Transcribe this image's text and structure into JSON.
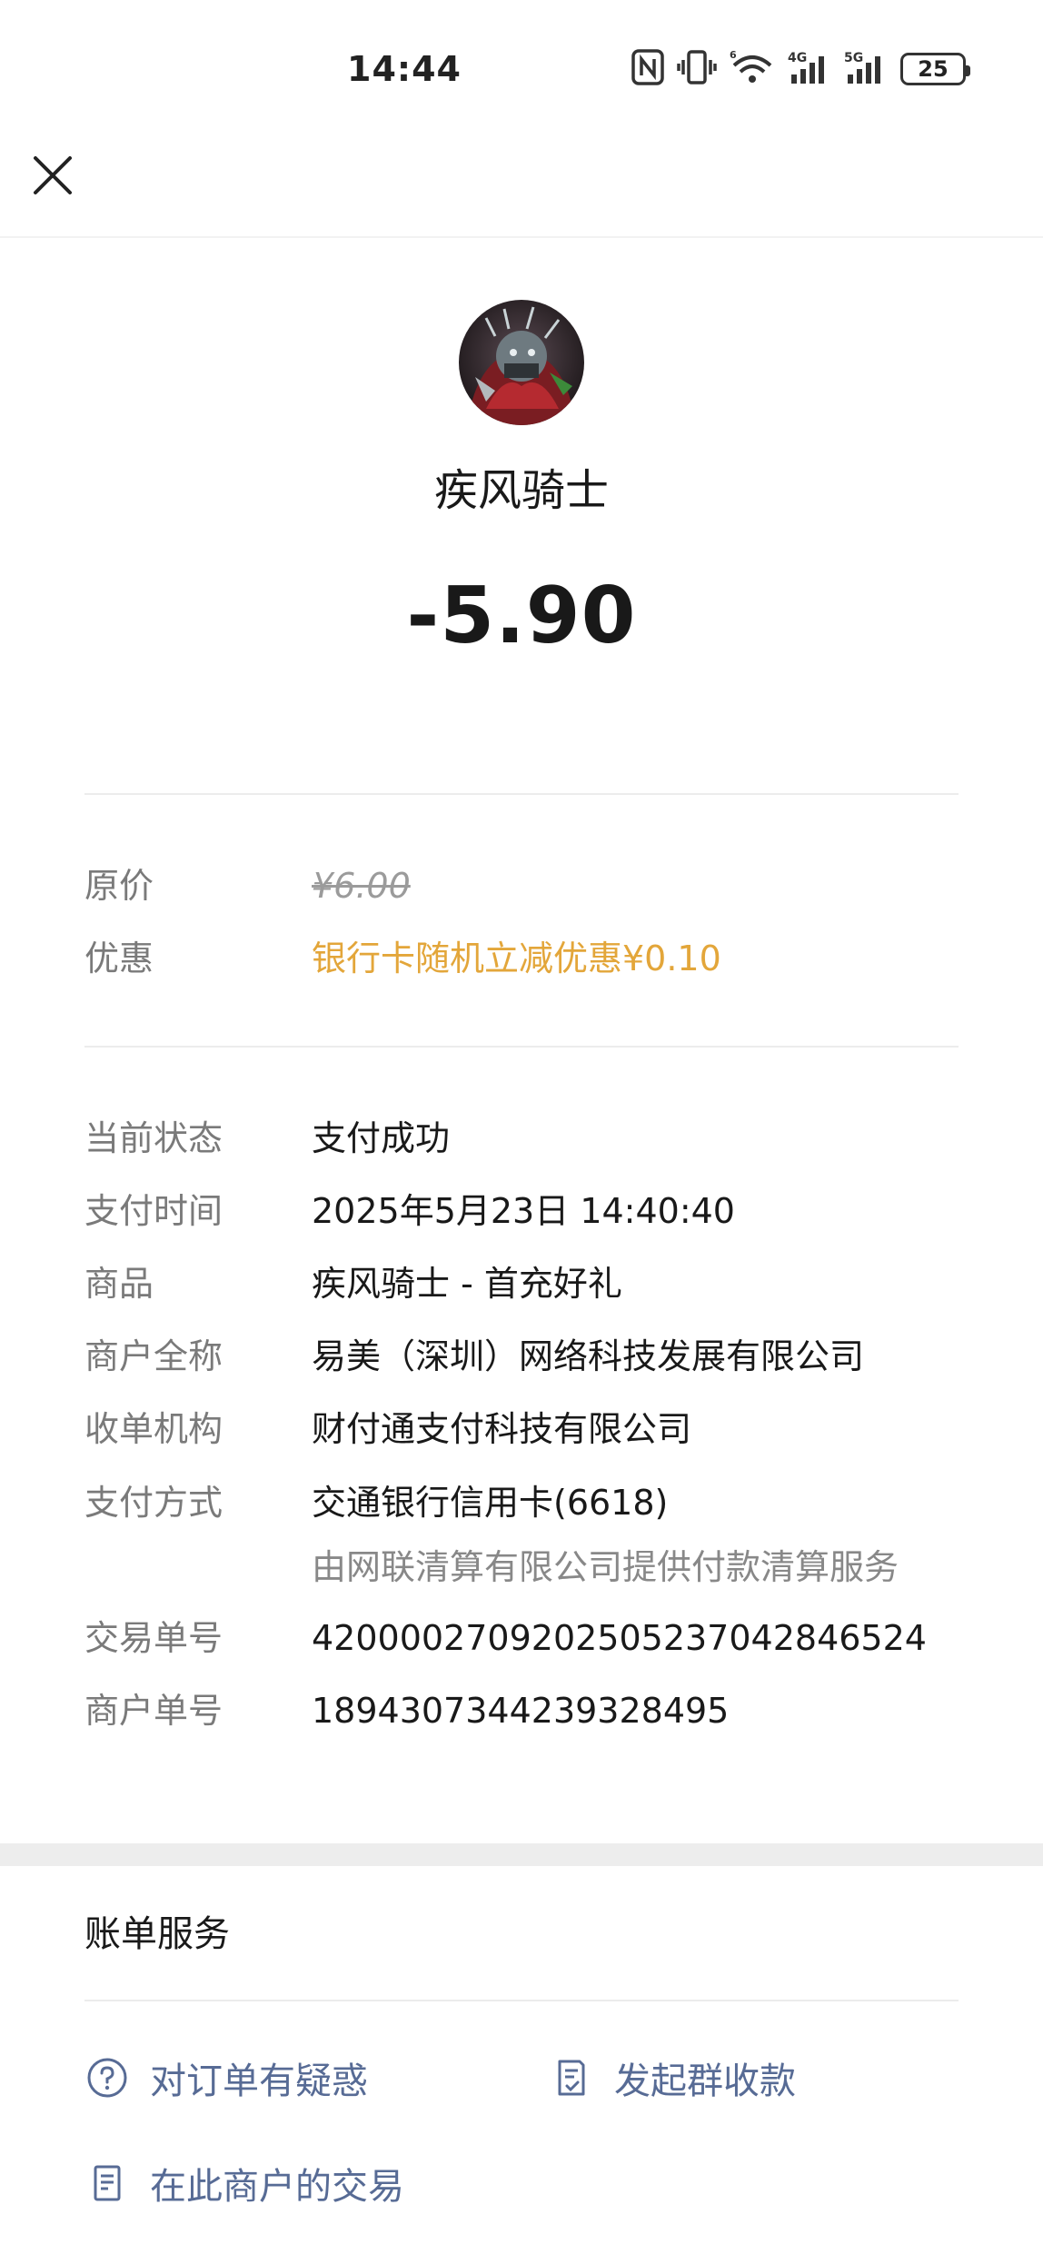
{
  "status_bar": {
    "time": "14:44",
    "battery_level": "25",
    "network_labels": [
      "4G",
      "5G"
    ]
  },
  "header": {
    "close_icon": "close-icon"
  },
  "merchant": {
    "name": "疾风骑士",
    "amount": "-5.90"
  },
  "pricing": {
    "original_label": "原价",
    "original_value": "¥6.00",
    "discount_label": "优惠",
    "discount_value": "银行卡随机立减优惠¥0.10"
  },
  "details": [
    {
      "label": "当前状态",
      "value": "支付成功"
    },
    {
      "label": "支付时间",
      "value": "2025年5月23日 14:40:40"
    },
    {
      "label": "商品",
      "value": "疾风骑士 - 首充好礼"
    },
    {
      "label": "商户全称",
      "value": "易美（深圳）网络科技发展有限公司"
    },
    {
      "label": "收单机构",
      "value": "财付通支付科技有限公司"
    },
    {
      "label": "支付方式",
      "value": "交通银行信用卡(6618)",
      "sub": "由网联清算有限公司提供付款清算服务"
    },
    {
      "label": "交易单号",
      "value": "4200002709202505237042846524"
    },
    {
      "label": "商户单号",
      "value": "1894307344239328495"
    }
  ],
  "services": {
    "title": "账单服务",
    "items": [
      {
        "label": "对订单有疑惑",
        "icon": "question-circle-icon"
      },
      {
        "label": "发起群收款",
        "icon": "checklist-document-icon"
      },
      {
        "label": "在此商户的交易",
        "icon": "document-list-icon"
      }
    ]
  },
  "colors": {
    "accent_link": "#576b95",
    "discount": "#e3a63a",
    "label_gray": "#7a7a7a"
  }
}
